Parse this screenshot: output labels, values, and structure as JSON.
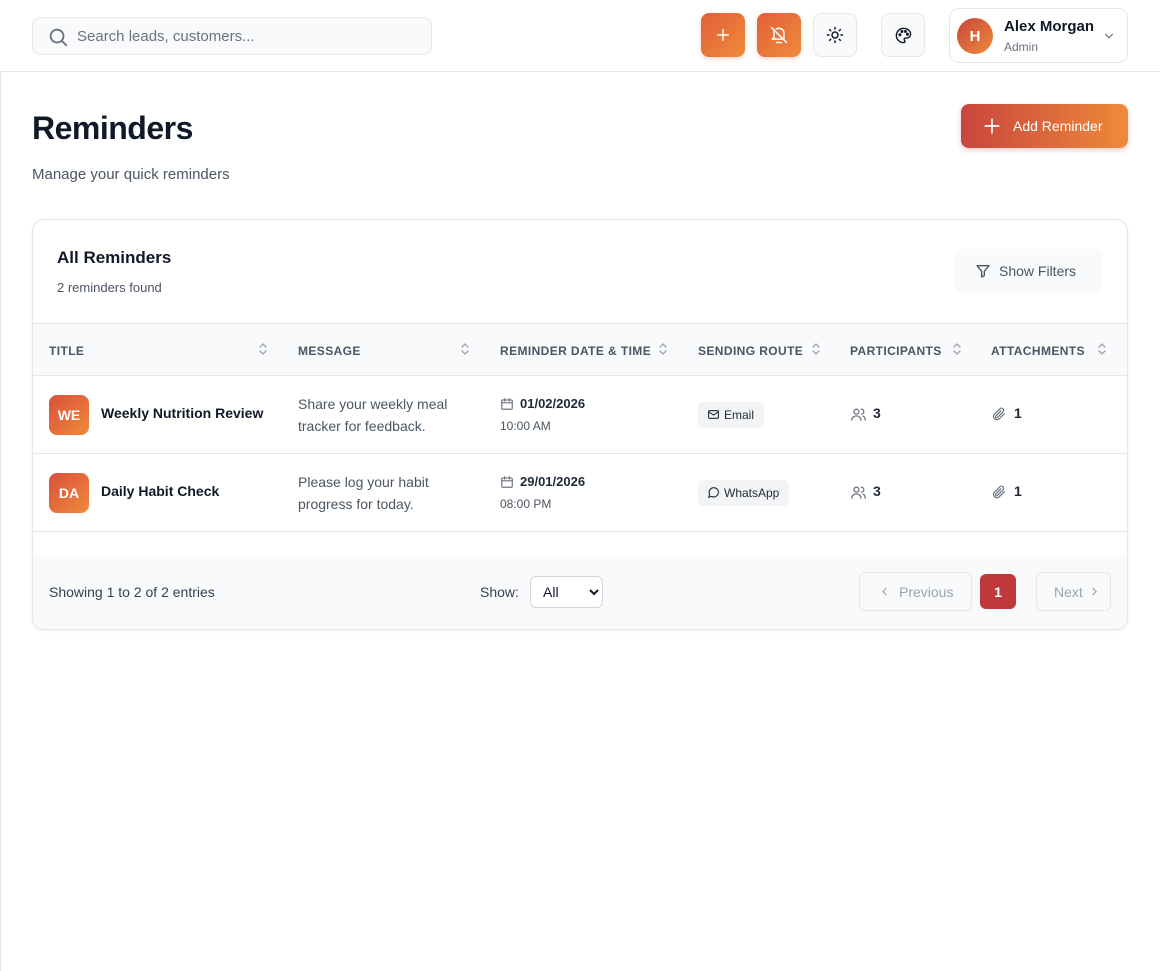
{
  "colors": {
    "accent": "#c0393c",
    "gradient_start": "#c8453d",
    "gradient_end": "#ef8a3a"
  },
  "search": {
    "placeholder": "Search leads, customers...",
    "value": ""
  },
  "topbar": {
    "icons": [
      "plus-icon",
      "bell-off-icon",
      "sun-icon",
      "palette-icon"
    ],
    "user": {
      "initial": "H",
      "name": "Alex Morgan",
      "role": "Admin"
    }
  },
  "page": {
    "title": "Reminders",
    "subtitle": "Manage your quick reminders",
    "add_label": "Add Reminder"
  },
  "card": {
    "title": "All Reminders",
    "count": "2 reminders found",
    "filters_label": "Show Filters"
  },
  "table": {
    "columns": [
      "TITLE",
      "MESSAGE",
      "REMINDER DATE & TIME",
      "SENDING ROUTE",
      "PARTICIPANTS",
      "ATTACHMENTS"
    ],
    "rows": [
      {
        "initials": "WE",
        "title": "Weekly Nutrition Review",
        "message": "Share your weekly meal tracker for feedback.",
        "date": "01/02/2026",
        "time": "10:00 AM",
        "route": "Email",
        "route_icon": "mail-icon",
        "participants": "3",
        "attachments": "1"
      },
      {
        "initials": "DA",
        "title": "Daily Habit Check",
        "message": "Please log your habit progress for today.",
        "date": "29/01/2026",
        "time": "08:00 PM",
        "route": "WhatsApp",
        "route_icon": "message-circle-icon",
        "participants": "3",
        "attachments": "1"
      }
    ]
  },
  "footer": {
    "showing": "Showing 1 to 2 of 2 entries",
    "show_label": "Show:",
    "show_value": "All",
    "previous": "Previous",
    "current_page": "1",
    "next": "Next"
  }
}
